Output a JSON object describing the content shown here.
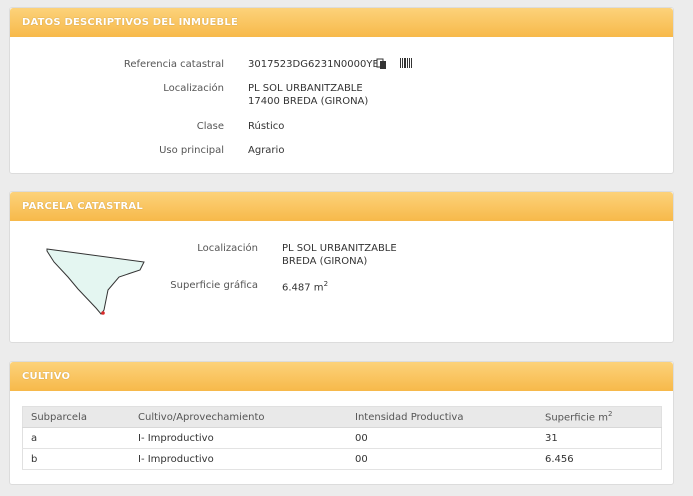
{
  "datos": {
    "title": "DATOS DESCRIPTIVOS DEL INMUEBLE",
    "fields": {
      "ref_label": "Referencia catastral",
      "ref_value": "3017523DG6231N0000YE",
      "loc_label": "Localización",
      "loc_line1": "PL SOL URBANITZABLE",
      "loc_line2": "17400 BREDA (GIRONA)",
      "clase_label": "Clase",
      "clase_value": "Rústico",
      "uso_label": "Uso principal",
      "uso_value": "Agrario"
    },
    "icons": [
      "copy-icon",
      "barcode-icon"
    ]
  },
  "parcela": {
    "title": "PARCELA CATASTRAL",
    "loc_label": "Localización",
    "loc_line1": "PL SOL URBANITZABLE",
    "loc_line2": "BREDA (GIRONA)",
    "sup_label": "Superficie gráfica",
    "sup_value": "6.487 m",
    "sup_unit_sup": "2"
  },
  "cultivo": {
    "title": "CULTIVO",
    "headers": [
      "Subparcela",
      "Cultivo/Aprovechamiento",
      "Intensidad Productiva",
      "Superficie m"
    ],
    "header_sup": "2",
    "rows": [
      [
        "a",
        "I- Improductivo",
        "00",
        "31"
      ],
      [
        "b",
        "I- Improductivo",
        "00",
        "6.456"
      ]
    ]
  },
  "colors": {
    "header_start": "#fcd27a",
    "header_end": "#f7b94a",
    "parcel_fill": "#e4f6f1",
    "parcel_marker": "#d92a2a"
  }
}
